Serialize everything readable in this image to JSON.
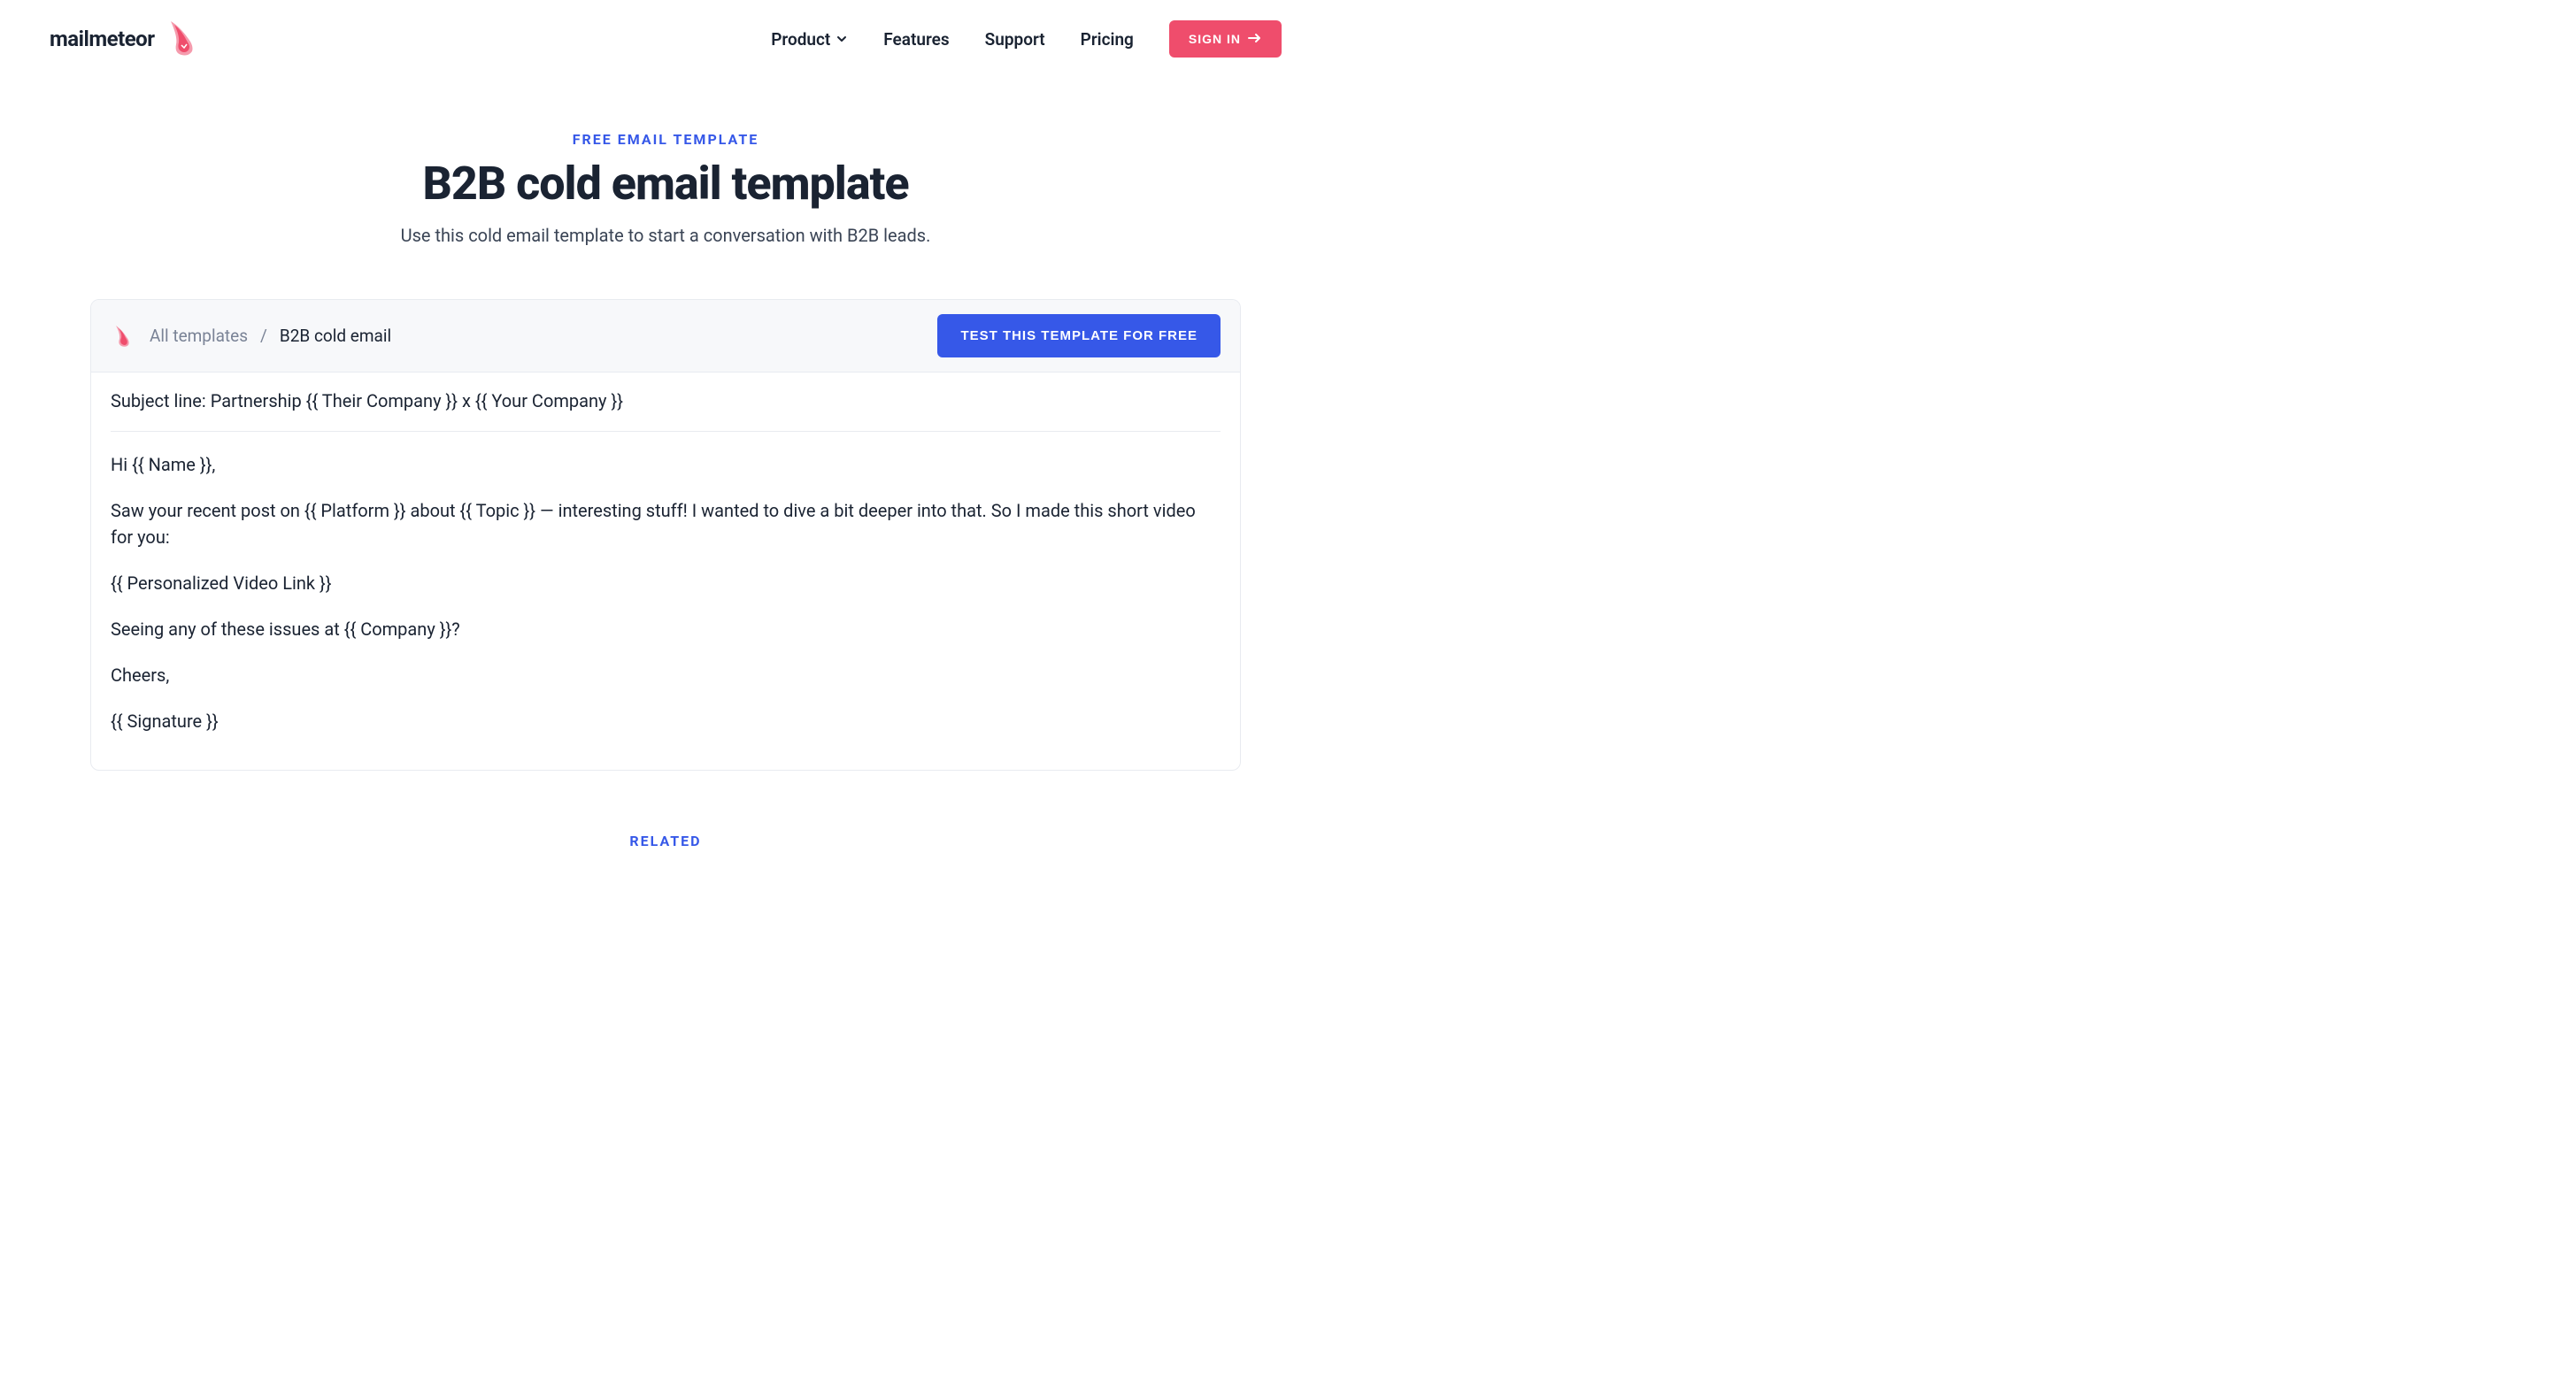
{
  "nav": {
    "brand": "mailmeteor",
    "items": {
      "product": "Product",
      "features": "Features",
      "support": "Support",
      "pricing": "Pricing"
    },
    "signin": "SIGN IN"
  },
  "hero": {
    "eyebrow": "FREE EMAIL TEMPLATE",
    "title": "B2B cold email template",
    "subtitle": "Use this cold email template to start a conversation with B2B leads."
  },
  "breadcrumb": {
    "all": "All templates",
    "sep": "/",
    "current": "B2B cold email"
  },
  "cta": {
    "test": "TEST THIS TEMPLATE FOR FREE"
  },
  "template": {
    "subject_label": "Subject line: ",
    "subject": "Partnership {{ Their Company }} x {{ Your Company }}",
    "body": {
      "p1": "Hi {{ Name }},",
      "p2": "Saw your recent post on {{ Platform }} about {{ Topic }} — interesting stuff! I wanted to dive a bit deeper into that. So I made this short video for you:",
      "p3": "{{ Personalized Video Link }}",
      "p4": "Seeing any of these issues at {{ Company }}?",
      "p5": "Cheers,",
      "p6": "{{ Signature }}"
    }
  },
  "related": {
    "label": "RELATED"
  },
  "colors": {
    "accent_pink": "#ef4d6c",
    "accent_blue": "#3658e8",
    "text_dark": "#1a2332"
  }
}
